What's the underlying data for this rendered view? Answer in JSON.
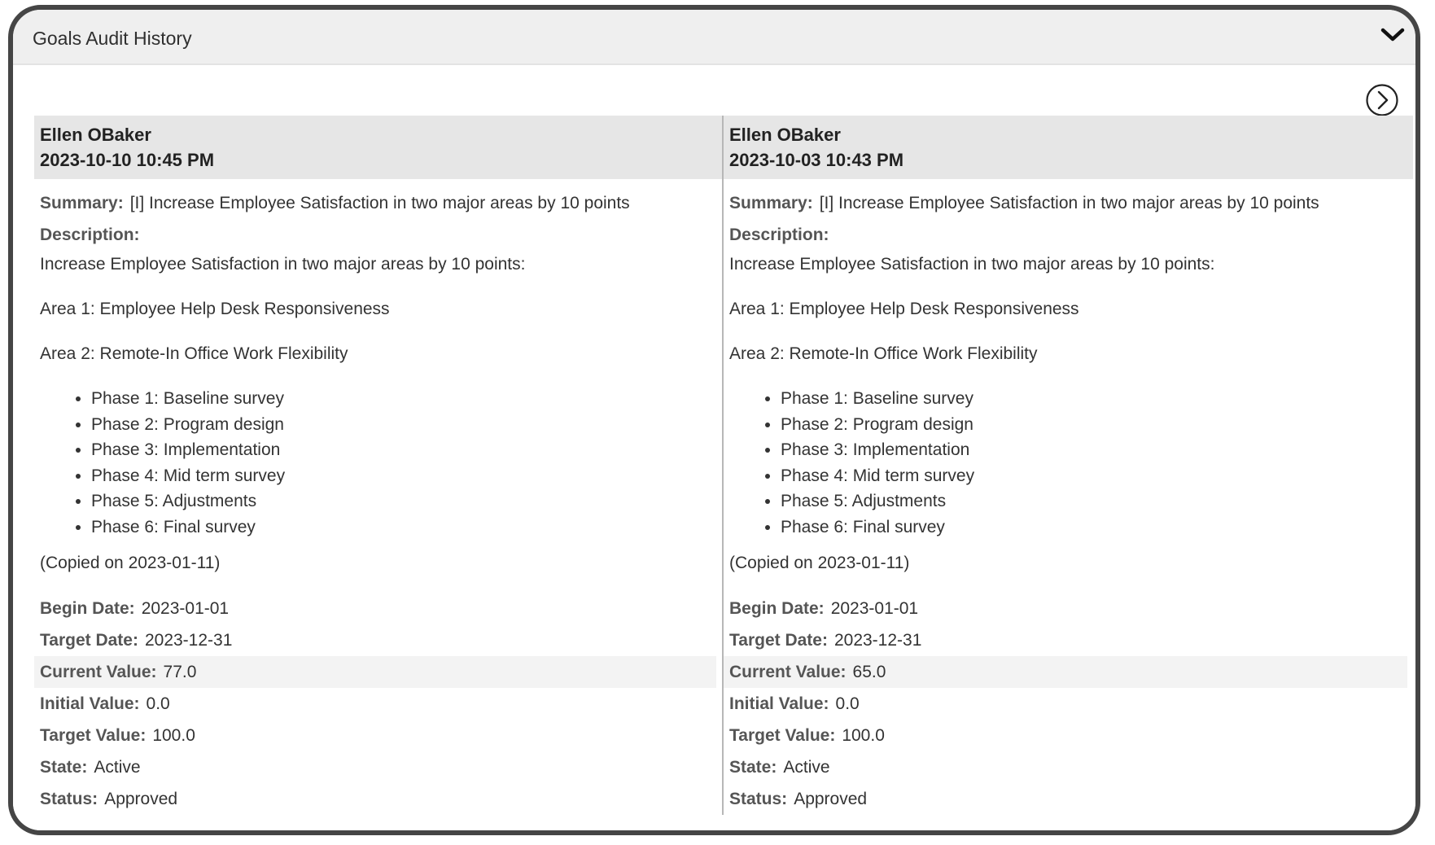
{
  "panel": {
    "title": "Goals Audit History",
    "collapse_icon": "chevron-down-icon",
    "next_icon": "circle-chevron-right-icon"
  },
  "entries": [
    {
      "author": "Ellen OBaker",
      "timestamp": "2023-10-10 10:45 PM",
      "summary_label": "Summary:",
      "summary": "[I] Increase Employee Satisfaction in two major areas by 10 points",
      "description_label": "Description:",
      "description_intro": "Increase Employee Satisfaction in two major areas by 10 points:",
      "area1": "Area 1: Employee Help Desk Responsiveness",
      "area2": "Area 2: Remote-In Office Work Flexibility",
      "phases": [
        "Phase 1: Baseline survey",
        "Phase 2: Program design",
        "Phase 3: Implementation",
        "Phase 4: Mid term survey",
        "Phase 5: Adjustments",
        "Phase 6: Final survey"
      ],
      "copied": "(Copied on 2023-01-11)",
      "begin_date_label": "Begin Date:",
      "begin_date": "2023-01-01",
      "target_date_label": "Target Date:",
      "target_date": "2023-12-31",
      "current_value_label": "Current Value:",
      "current_value": "77.0",
      "initial_value_label": "Initial Value:",
      "initial_value": "0.0",
      "target_value_label": "Target Value:",
      "target_value": "100.0",
      "state_label": "State:",
      "state": "Active",
      "status_label": "Status:",
      "status": "Approved"
    },
    {
      "author": "Ellen OBaker",
      "timestamp": "2023-10-03 10:43 PM",
      "summary_label": "Summary:",
      "summary": "[I] Increase Employee Satisfaction in two major areas by 10 points",
      "description_label": "Description:",
      "description_intro": "Increase Employee Satisfaction in two major areas by 10 points:",
      "area1": "Area 1: Employee Help Desk Responsiveness",
      "area2": "Area 2: Remote-In Office Work Flexibility",
      "phases": [
        "Phase 1: Baseline survey",
        "Phase 2: Program design",
        "Phase 3: Implementation",
        "Phase 4: Mid term survey",
        "Phase 5: Adjustments",
        "Phase 6: Final survey"
      ],
      "copied": "(Copied on 2023-01-11)",
      "begin_date_label": "Begin Date:",
      "begin_date": "2023-01-01",
      "target_date_label": "Target Date:",
      "target_date": "2023-12-31",
      "current_value_label": "Current Value:",
      "current_value": "65.0",
      "initial_value_label": "Initial Value:",
      "initial_value": "0.0",
      "target_value_label": "Target Value:",
      "target_value": "100.0",
      "state_label": "State:",
      "state": "Active",
      "status_label": "Status:",
      "status": "Approved"
    }
  ]
}
